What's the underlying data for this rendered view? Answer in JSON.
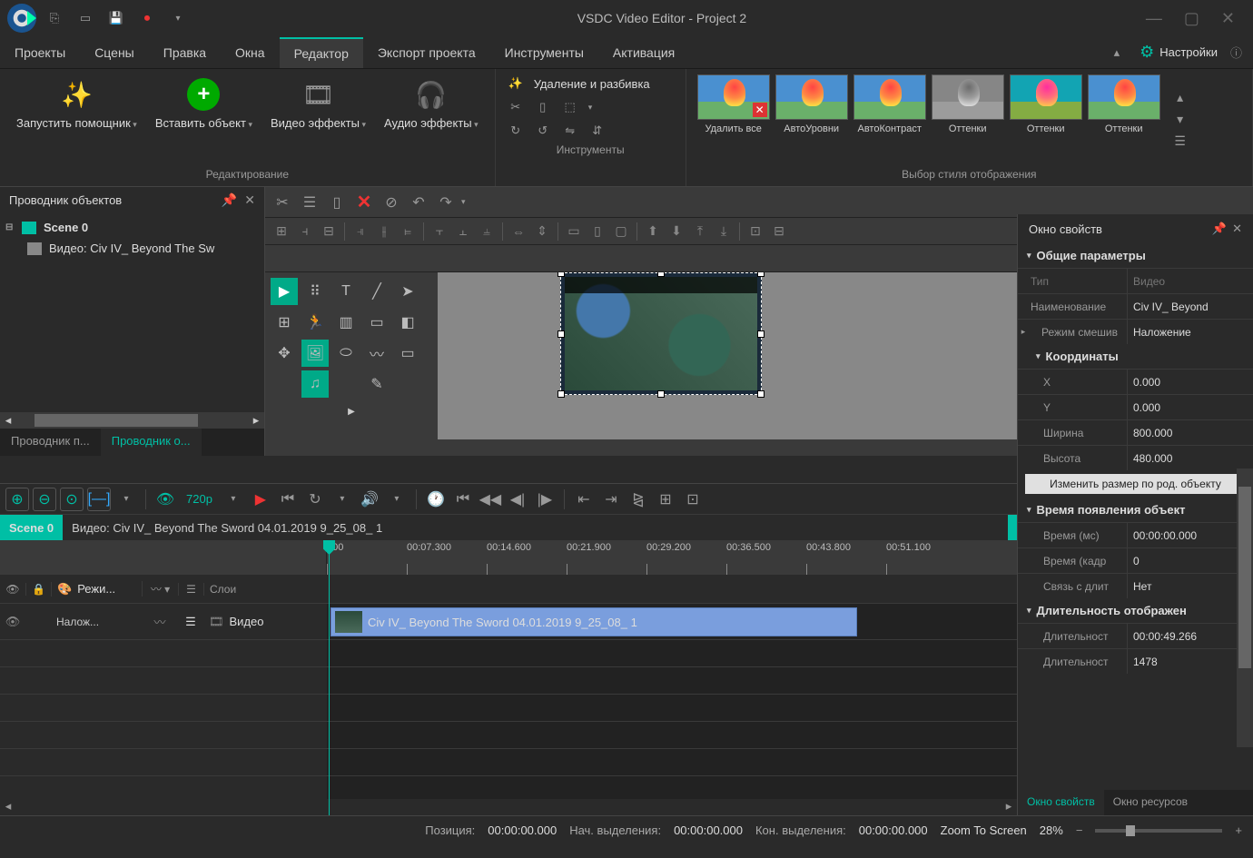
{
  "title": "VSDC Video Editor - Project 2",
  "menu": {
    "projects": "Проекты",
    "scenes": "Сцены",
    "edit": "Правка",
    "windows": "Окна",
    "editor": "Редактор",
    "export": "Экспорт проекта",
    "tools": "Инструменты",
    "activation": "Активация",
    "settings": "Настройки"
  },
  "ribbon": {
    "wizard": "Запустить помощник",
    "insert": "Вставить объект",
    "vfx": "Видео эффекты",
    "afx": "Аудио эффекты",
    "g1": "Редактирование",
    "tools_lbl": "Удаление и разбивка",
    "g2": "Инструменты",
    "styles": [
      "Удалить все",
      "АвтоУровни",
      "АвтоКонтраст",
      "Оттенки",
      "Оттенки",
      "Оттенки"
    ],
    "g3": "Выбор стиля отображения"
  },
  "explorer": {
    "title": "Проводник объектов",
    "scene": "Scene 0",
    "video": "Видео: Civ IV_ Beyond The Sw",
    "tab1": "Проводник п...",
    "tab2": "Проводник о..."
  },
  "props": {
    "title": "Окно свойств",
    "s1": "Общие параметры",
    "type_k": "Тип",
    "type_v": "Видео",
    "name_k": "Наименование",
    "name_v": "Civ IV_ Beyond",
    "blend_k": "Режим смешив",
    "blend_v": "Наложение",
    "s2": "Координаты",
    "x_k": "X",
    "x_v": "0.000",
    "y_k": "Y",
    "y_v": "0.000",
    "w_k": "Ширина",
    "w_v": "800.000",
    "h_k": "Высота",
    "h_v": "480.000",
    "resize": "Изменить размер по род. объекту",
    "s3": "Время появления объект",
    "tms_k": "Время (мс)",
    "tms_v": "00:00:00.000",
    "tfr_k": "Время (кадр",
    "tfr_v": "0",
    "link_k": "Связь с длит",
    "link_v": "Нет",
    "s4": "Длительность отображен",
    "dur_k": "Длительност",
    "dur_v": "00:00:49.266",
    "durf_k": "Длительност",
    "durf_v": "1478",
    "tab1": "Окно свойств",
    "tab2": "Окно ресурсов"
  },
  "timeline": {
    "res": "720p",
    "scene": "Scene 0",
    "path": "Видео: Civ IV_ Beyond The Sword 04.01.2019 9_25_08_ 1",
    "marks": [
      "000",
      "00:07.300",
      "00:14.600",
      "00:21.900",
      "00:29.200",
      "00:36.500",
      "00:43.800",
      "00:51.100"
    ],
    "hdr_mode": "Режи...",
    "hdr_layers": "Слои",
    "track_mode": "Налож...",
    "track_name": "Видео",
    "clip": "Civ IV_ Beyond The Sword 04.01.2019 9_25_08_ 1"
  },
  "status": {
    "pos_k": "Позиция:",
    "pos_v": "00:00:00.000",
    "sel_start_k": "Нач. выделения:",
    "sel_start_v": "00:00:00.000",
    "sel_end_k": "Кон. выделения:",
    "sel_end_v": "00:00:00.000",
    "zoom_mode": "Zoom To Screen",
    "zoom": "28%"
  }
}
